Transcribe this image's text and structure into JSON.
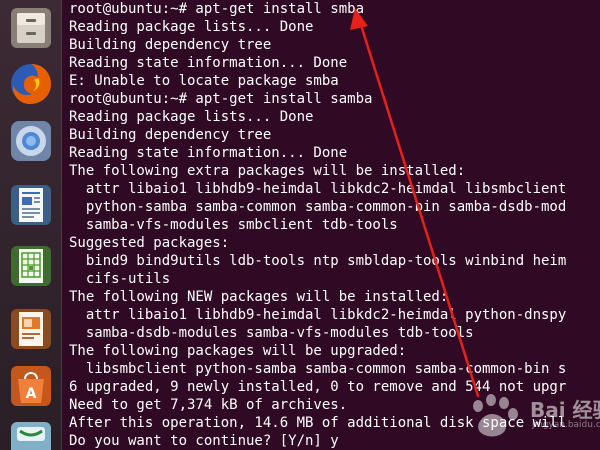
{
  "launcher": {
    "items": [
      {
        "name": "files-icon"
      },
      {
        "name": "firefox-icon"
      },
      {
        "name": "chromium-icon"
      },
      {
        "name": "writer-icon"
      },
      {
        "name": "calc-icon"
      },
      {
        "name": "impress-icon"
      },
      {
        "name": "software-center-icon"
      },
      {
        "name": "amazon-icon"
      }
    ]
  },
  "terminal": {
    "lines": [
      "root@ubuntu:~# apt-get install smba",
      "Reading package lists... Done",
      "Building dependency tree",
      "Reading state information... Done",
      "E: Unable to locate package smba",
      "root@ubuntu:~# apt-get install samba",
      "Reading package lists... Done",
      "Building dependency tree",
      "Reading state information... Done",
      "The following extra packages will be installed:",
      "  attr libaio1 libhdb9-heimdal libkdc2-heimdal libsmbclient",
      "  python-samba samba-common samba-common-bin samba-dsdb-mod",
      "  samba-vfs-modules smbclient tdb-tools",
      "Suggested packages:",
      "  bind9 bind9utils ldb-tools ntp smbldap-tools winbind heim",
      "  cifs-utils",
      "The following NEW packages will be installed:",
      "  attr libaio1 libhdb9-heimdal libkdc2-heimdal python-dnspy",
      "  samba-dsdb-modules samba-vfs-modules tdb-tools",
      "The following packages will be upgraded:",
      "  libsmbclient python-samba samba-common samba-common-bin s",
      "6 upgraded, 9 newly installed, 0 to remove and 544 not upgr",
      "Need to get 7,374 kB of archives.",
      "After this operation, 14.6 MB of additional disk space will",
      "Do you want to continue? [Y/n] y"
    ]
  },
  "watermark": {
    "text": "Bai 经验",
    "subtext": "jingyan.baidu.com"
  },
  "colors": {
    "terminal_bg": "#300a24",
    "terminal_fg": "#ffffff",
    "annotation_arrow": "#e8201c"
  }
}
